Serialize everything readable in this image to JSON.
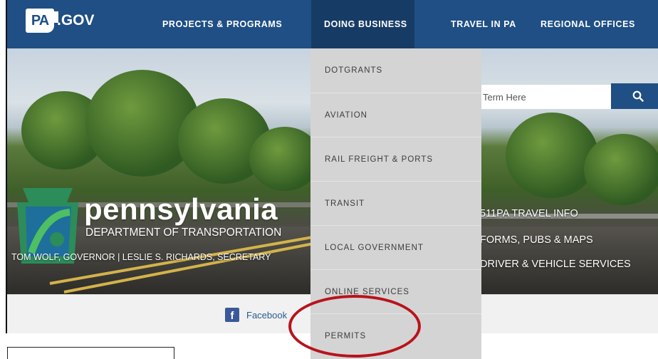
{
  "logo": {
    "mark": "PA",
    "text": ".GOV"
  },
  "nav": [
    {
      "label": "PROJECTS & PROGRAMS"
    },
    {
      "label": "DOING BUSINESS"
    },
    {
      "label": "TRAVEL IN PA"
    },
    {
      "label": "REGIONAL OFFICES"
    }
  ],
  "hero": {
    "brand": "pennsylvania",
    "department": "DEPARTMENT OF TRANSPORTATION",
    "governor_line": "TOM WOLF, GOVERNOR  |  LESLIE S. RICHARDS, SECRETARY"
  },
  "search": {
    "placeholder": "Term Here",
    "value": "Term Here",
    "icon": "search-icon"
  },
  "quick_links": [
    {
      "label": "511PA TRAVEL INFO"
    },
    {
      "label": "FORMS, PUBS & MAPS"
    },
    {
      "label": "DRIVER & VEHICLE SERVICES"
    }
  ],
  "dropdown": {
    "items": [
      {
        "label": "DOTGRANTS"
      },
      {
        "label": "AVIATION"
      },
      {
        "label": "RAIL FREIGHT & PORTS"
      },
      {
        "label": "TRANSIT"
      },
      {
        "label": "LOCAL GOVERNMENT"
      },
      {
        "label": "ONLINE SERVICES"
      },
      {
        "label": "PERMITS"
      }
    ]
  },
  "social": {
    "facebook_label": "Facebook",
    "facebook_icon": "f"
  },
  "colors": {
    "nav_bg": "#1f4f84",
    "nav_active": "#163c66",
    "dropdown_bg": "#d4d4d4",
    "highlight": "#b8131c"
  }
}
